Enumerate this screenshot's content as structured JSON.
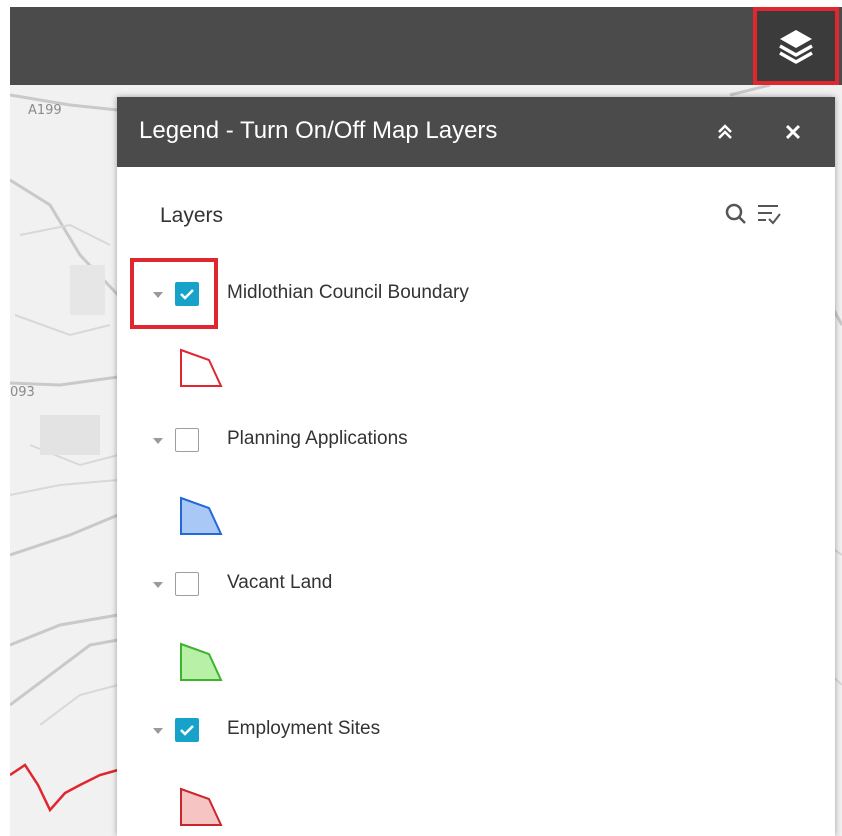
{
  "map": {
    "road_labels": [
      "A199",
      "093"
    ],
    "boundary_color": "#e0262e"
  },
  "toolbar": {
    "layers_button_icon": "layers-icon"
  },
  "panel": {
    "title": "Legend - Turn On/Off Map Layers",
    "collapse_icon": "double-chevron-up-icon",
    "close_icon": "close-icon",
    "heading": "Layers",
    "search_icon": "search-icon",
    "filter_icon": "filter-list-icon"
  },
  "layers": [
    {
      "label": "Midlothian Council Boundary",
      "checked": true,
      "swatch_fill": "#ffffff",
      "swatch_stroke": "#e0262e"
    },
    {
      "label": "Planning Applications",
      "checked": false,
      "swatch_fill": "#a9c8f5",
      "swatch_stroke": "#2468d8"
    },
    {
      "label": "Vacant Land",
      "checked": false,
      "swatch_fill": "#b8f0a8",
      "swatch_stroke": "#3cb52a"
    },
    {
      "label": "Employment Sites",
      "checked": true,
      "swatch_fill": "#f7c4c4",
      "swatch_stroke": "#c8252c"
    }
  ],
  "colors": {
    "header_bg": "#4b4b4b",
    "checkbox_on": "#17a2c9",
    "highlight": "#e0262e"
  }
}
